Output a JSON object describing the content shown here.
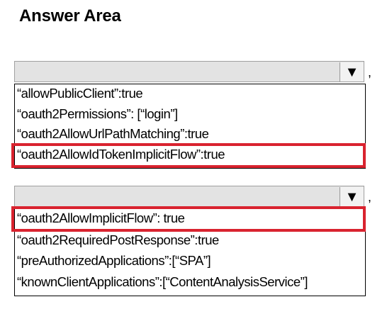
{
  "answer_area": {
    "title": "Answer Area"
  },
  "dropdowns": [
    {
      "selected_value": "",
      "trailing_punctuation": ",",
      "arrow_icon": "chevron-down-icon",
      "options": [
        "“allowPublicClient”:true",
        "“oauth2Permissions”: [“login”]",
        "“oauth2AllowUrlPathMatching”:true",
        "“oauth2AllowIdTokenImplicitFlow”:true"
      ],
      "highlighted_option_index": 3
    },
    {
      "selected_value": "",
      "trailing_punctuation": ",",
      "arrow_icon": "chevron-down-icon",
      "options": [
        "“oauth2AllowImplicitFlow”: true",
        "“oauth2RequiredPostResponse”:true",
        "“preAuthorizedApplications”:[“SPA”]",
        "“knownClientApplications”:[“ContentAnalysisService”]"
      ],
      "highlighted_option_index": 0
    }
  ],
  "colors": {
    "highlight": "#d9232f",
    "dropdown_header": "#e3e3e3"
  }
}
